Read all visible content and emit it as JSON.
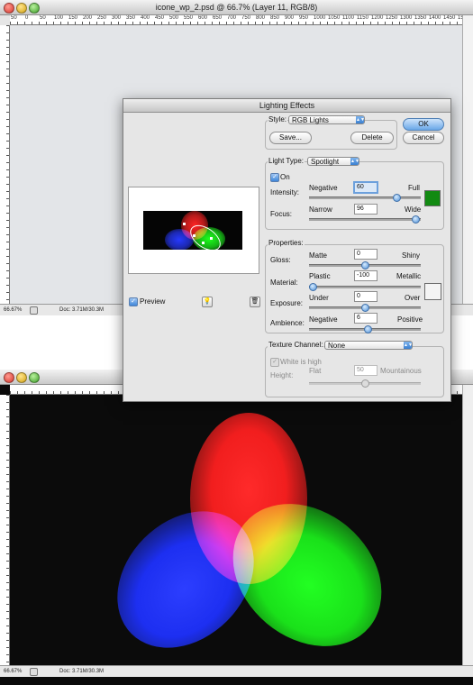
{
  "window_top": {
    "title": "icone_wp_2.psd @ 66.7% (Layer 11, RGB/8)",
    "ruler_numbers": [
      "50",
      "0",
      "50",
      "100",
      "150",
      "200",
      "250",
      "300",
      "350",
      "400",
      "450",
      "500",
      "550",
      "600",
      "650",
      "700",
      "750",
      "800",
      "850",
      "900",
      "950",
      "1000",
      "1050",
      "1100",
      "1150",
      "1200",
      "1250",
      "1300",
      "1350",
      "1400",
      "1450",
      "1500"
    ],
    "zoom": "66.67%",
    "doc_size": "Doc: 3.71M/30.3M",
    "canvas_color": "#e3e5e8"
  },
  "window_bottom": {
    "zoom": "66.67%",
    "doc_size": "Doc: 3.71M/30.3M",
    "canvas_color": "#0b0b0b"
  },
  "dialog": {
    "title": "Lighting Effects",
    "style_label": "Style:",
    "style_value": "RGB Lights",
    "save_label": "Save...",
    "delete_label": "Delete",
    "ok_label": "OK",
    "cancel_label": "Cancel",
    "light_type_label": "Light Type:",
    "light_type_value": "Spotlight",
    "on_label": "On",
    "on_checked": true,
    "intensity": {
      "label": "Intensity:",
      "min_label": "Negative",
      "max_label": "Full",
      "value": "60",
      "level": 0.8
    },
    "focus": {
      "label": "Focus:",
      "min_label": "Narrow",
      "max_label": "Wide",
      "value": "96",
      "level": 0.98
    },
    "light_color": "#128a12",
    "properties_label": "Properties:",
    "gloss": {
      "label": "Gloss:",
      "min_label": "Matte",
      "max_label": "Shiny",
      "value": "0",
      "level": 0.5
    },
    "material": {
      "label": "Material:",
      "min_label": "Plastic",
      "max_label": "Metallic",
      "value": "-100",
      "level": 0.0
    },
    "exposure": {
      "label": "Exposure:",
      "min_label": "Under",
      "max_label": "Over",
      "value": "0",
      "level": 0.5
    },
    "ambience": {
      "label": "Ambience:",
      "min_label": "Negative",
      "max_label": "Positive",
      "value": "6",
      "level": 0.53
    },
    "ambient_color": "#f4f4f4",
    "texture_channel_label": "Texture Channel:",
    "texture_channel_value": "None",
    "white_is_high_label": "White is high",
    "height": {
      "label": "Height:",
      "min_label": "Flat",
      "max_label": "Mountainous",
      "value": "50",
      "level": 0.5
    },
    "preview_label": "Preview",
    "preview_checked": true
  },
  "lights": [
    {
      "name": "red",
      "color": "#ff1a1a"
    },
    {
      "name": "green",
      "color": "#12e012"
    },
    {
      "name": "blue",
      "color": "#1a2cff"
    }
  ]
}
